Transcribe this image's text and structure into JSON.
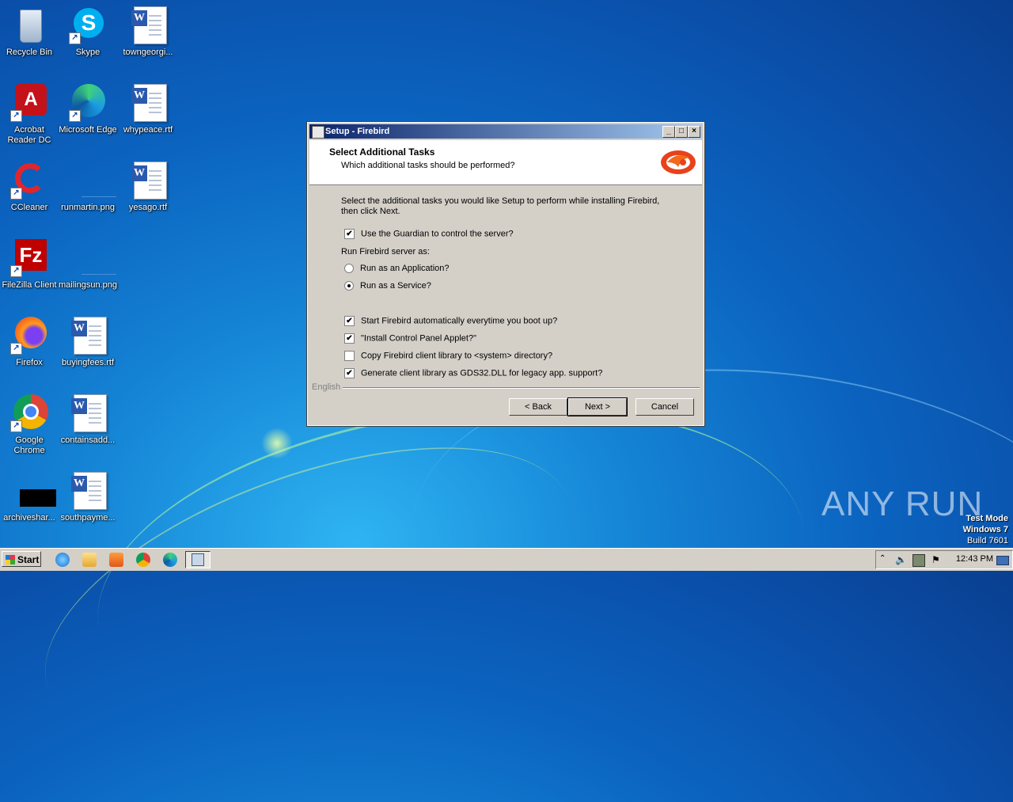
{
  "desktop": {
    "icons": [
      {
        "label": "Recycle Bin"
      },
      {
        "label": "Skype"
      },
      {
        "label": "towngeorgi..."
      },
      {
        "label": "Acrobat Reader DC"
      },
      {
        "label": "Microsoft Edge"
      },
      {
        "label": "whypeace.rtf"
      },
      {
        "label": "CCleaner"
      },
      {
        "label": "runmartin.png"
      },
      {
        "label": "yesago.rtf"
      },
      {
        "label": "FileZilla Client"
      },
      {
        "label": "mailingsun.png"
      },
      {
        "label": "Firefox"
      },
      {
        "label": "buyingfees.rtf"
      },
      {
        "label": "Google Chrome"
      },
      {
        "label": "containsadd..."
      },
      {
        "label": "archiveshar..."
      },
      {
        "label": "southpayme..."
      }
    ]
  },
  "dialog": {
    "title": "Setup - Firebird",
    "heading": "Select Additional Tasks",
    "subheading": "Which additional tasks should be performed?",
    "intro": "Select the additional tasks you would like Setup to perform while installing Firebird, then click Next.",
    "guardian": {
      "label": "Use the Guardian to control the server?",
      "checked": true
    },
    "run_as_label": "Run Firebird server as:",
    "radio_app": {
      "label": "Run as an Application?",
      "selected": false
    },
    "radio_service": {
      "label": "Run as a Service?",
      "selected": true
    },
    "autostart": {
      "label": "Start Firebird automatically everytime you boot up?",
      "checked": true
    },
    "applet": {
      "label": "\"Install Control Panel Applet?\"",
      "checked": true
    },
    "copy_lib": {
      "label": "Copy Firebird client library to <system> directory?",
      "checked": false
    },
    "gds32": {
      "label": "Generate client library as GDS32.DLL for legacy app. support?",
      "checked": true
    },
    "language": "English",
    "back_label": "< Back",
    "next_label": "Next >",
    "cancel_label": "Cancel",
    "minimize_glyph": "_",
    "maximize_glyph": "□",
    "close_glyph": "×",
    "check_glyph": "✔"
  },
  "taskbar": {
    "start_label": "Start",
    "clock": "12:43 PM"
  },
  "watermark": {
    "brand": "ANY RUN",
    "mode": "Test Mode",
    "os": "Windows 7",
    "build": "Build 7601"
  }
}
